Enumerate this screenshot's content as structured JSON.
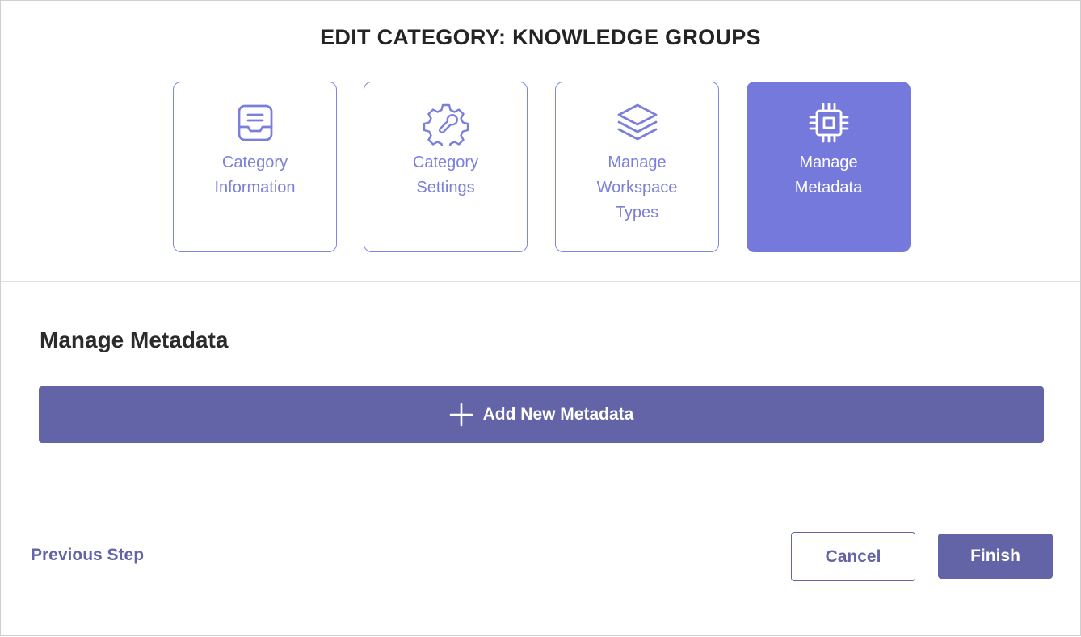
{
  "dialog": {
    "title": "EDIT CATEGORY: KNOWLEDGE GROUPS"
  },
  "steps": [
    {
      "label": "Category Information",
      "icon": "inbox-tray-icon",
      "active": false
    },
    {
      "label": "Category Settings",
      "icon": "gear-wrench-icon",
      "active": false
    },
    {
      "label": "Manage Workspace Types",
      "icon": "layers-icon",
      "active": false
    },
    {
      "label": "Manage Metadata",
      "icon": "chip-icon",
      "active": true
    }
  ],
  "section": {
    "title": "Manage Metadata",
    "add_button_label": "Add New Metadata",
    "add_button_icon": "plus-icon"
  },
  "footer": {
    "previous_label": "Previous Step",
    "cancel_label": "Cancel",
    "finish_label": "Finish"
  },
  "colors": {
    "accent": "#6264a7",
    "step_border": "#7f85e3",
    "step_active_bg": "#7579dc",
    "step_text": "#7b7fd9"
  }
}
